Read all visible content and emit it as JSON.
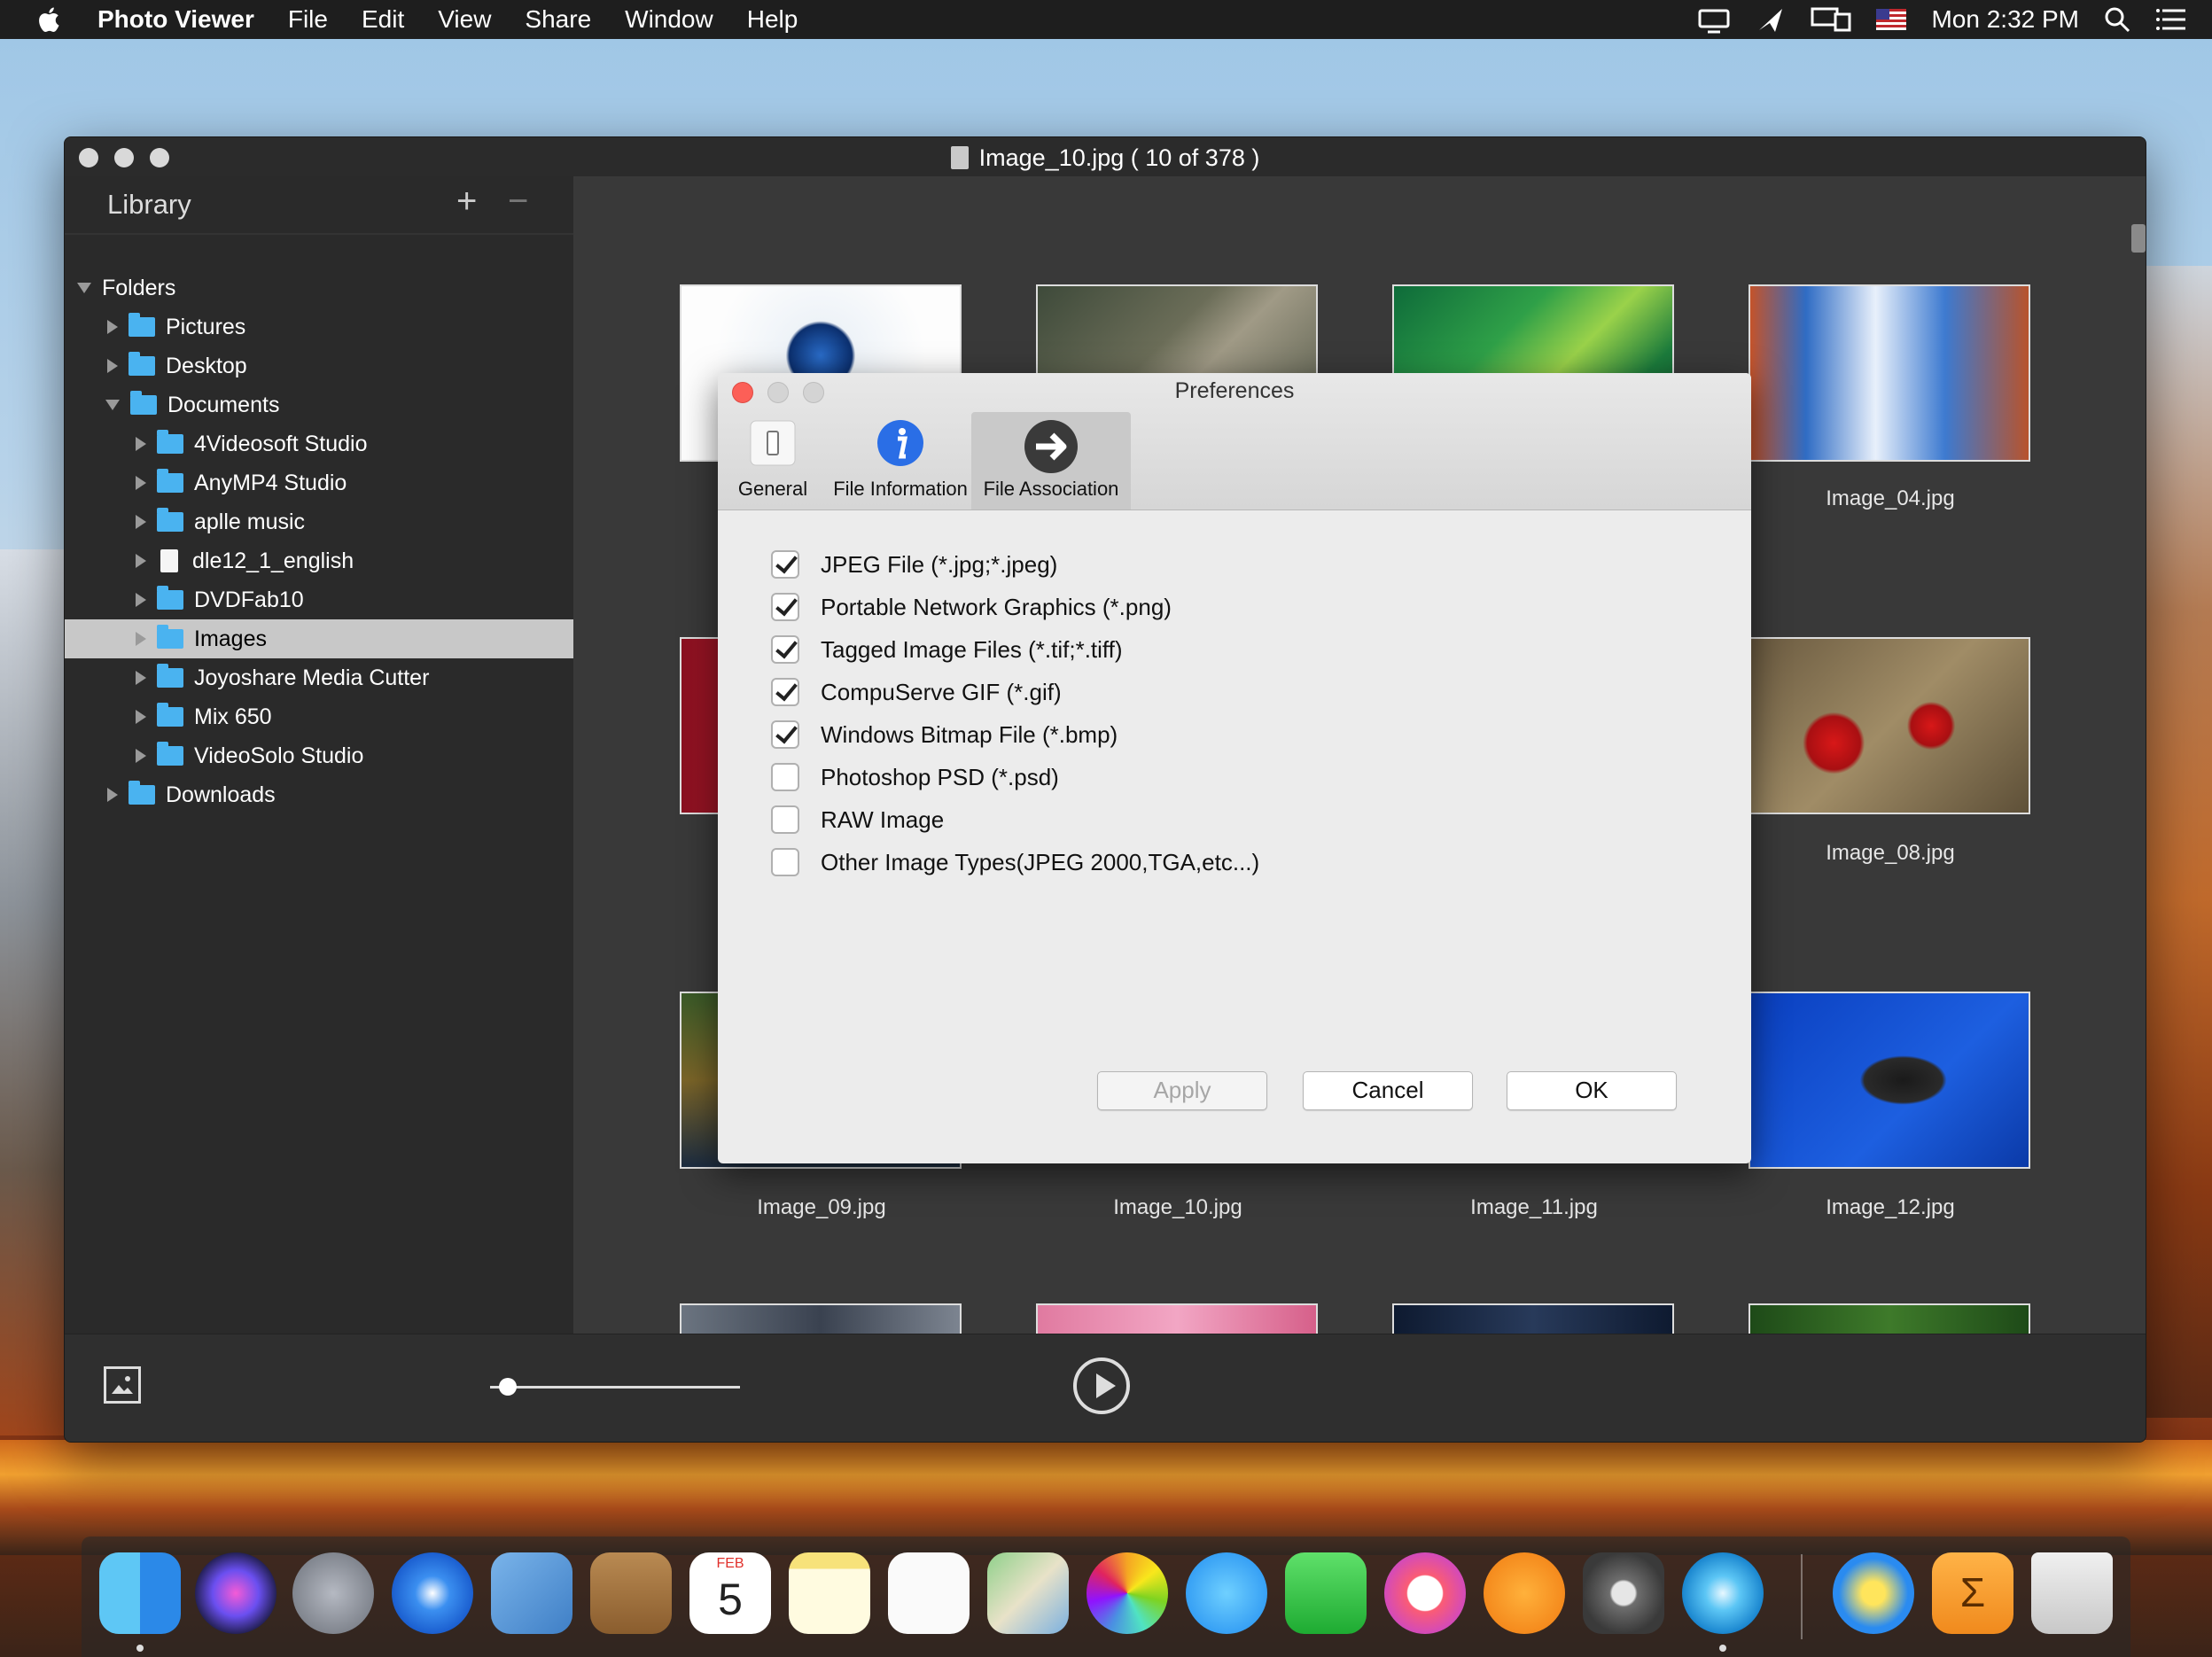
{
  "menubar": {
    "app_name": "Photo Viewer",
    "menus": [
      "File",
      "Edit",
      "View",
      "Share",
      "Window",
      "Help"
    ],
    "clock": "Mon 2:32 PM"
  },
  "window": {
    "title": "Image_10.jpg ( 10 of 378 )"
  },
  "library": {
    "title": "Library",
    "add_label": "+",
    "remove_label": "−",
    "tree": {
      "folders": "Folders",
      "pictures": "Pictures",
      "desktop": "Desktop",
      "documents": "Documents",
      "doc_items": [
        "4Videosoft Studio",
        "AnyMP4 Studio",
        "aplle music",
        "dle12_1_english",
        "DVDFab10",
        "Images",
        "Joyoshare Media Cutter",
        "Mix 650",
        "VideoSolo Studio"
      ],
      "downloads": "Downloads"
    },
    "selected": "Images"
  },
  "grid": {
    "captions": [
      "Image_04.jpg",
      "Image_08.jpg",
      "Image_09.jpg",
      "Image_10.jpg",
      "Image_11.jpg",
      "Image_12.jpg"
    ]
  },
  "preferences": {
    "title": "Preferences",
    "tabs": [
      "General",
      "File Information",
      "File Association"
    ],
    "active_tab": "File Association",
    "options": [
      {
        "label": "JPEG File (*.jpg;*.jpeg)",
        "checked": true
      },
      {
        "label": "Portable Network Graphics (*.png)",
        "checked": true
      },
      {
        "label": "Tagged Image Files (*.tif;*.tiff)",
        "checked": true
      },
      {
        "label": "CompuServe GIF (*.gif)",
        "checked": true
      },
      {
        "label": "Windows Bitmap File (*.bmp)",
        "checked": true
      },
      {
        "label": "Photoshop PSD (*.psd)",
        "checked": false
      },
      {
        "label": "RAW Image",
        "checked": false
      },
      {
        "label": "Other Image Types(JPEG 2000,TGA,etc...)",
        "checked": false
      }
    ],
    "buttons": {
      "apply": "Apply",
      "cancel": "Cancel",
      "ok": "OK"
    }
  },
  "dock": {
    "calendar_month": "FEB",
    "calendar_day": "5",
    "icons": [
      "finder-icon",
      "siri-icon",
      "launchpad-icon",
      "safari-icon",
      "mail-icon",
      "contacts-icon",
      "calendar-icon",
      "notes-icon",
      "reminders-icon",
      "maps-icon",
      "photos-icon",
      "messages-icon",
      "facetime-icon",
      "itunes-icon",
      "ibooks-icon",
      "system-preferences-icon",
      "photo-viewer-icon",
      "app-icon",
      "sigma-folder-icon",
      "trash-icon"
    ]
  },
  "colors": {
    "accent_blue": "#4ab3f0",
    "selection": "#c8c8c8",
    "close_red": "#fc5f57"
  }
}
